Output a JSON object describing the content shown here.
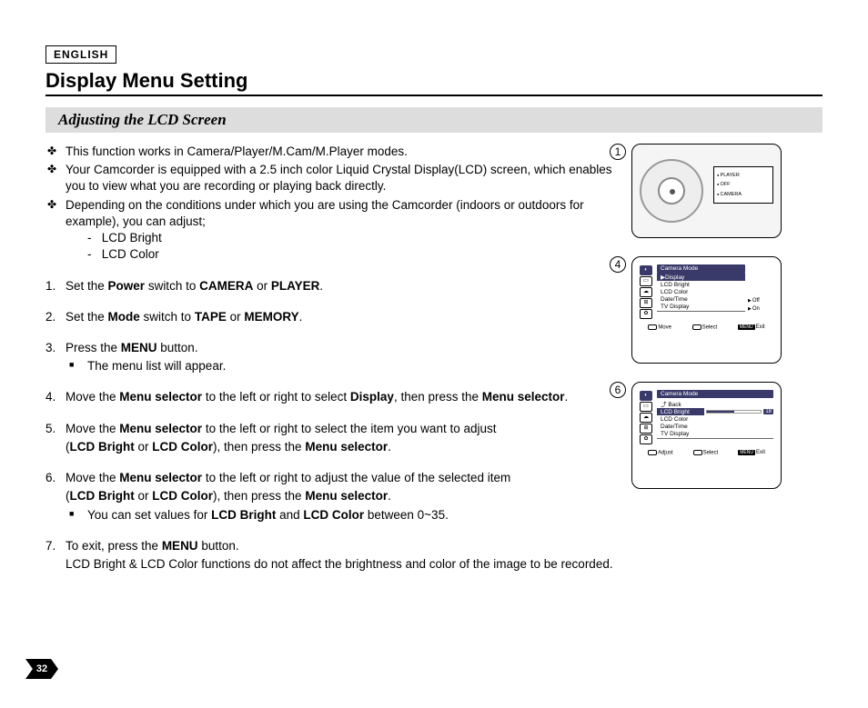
{
  "lang": "ENGLISH",
  "title": "Display Menu Setting",
  "subtitle": "Adjusting the LCD Screen",
  "bullets": [
    "This function works in Camera/Player/M.Cam/M.Player modes.",
    "Your Camcorder is equipped with a 2.5 inch color Liquid Crystal Display(LCD) screen, which enables you to view what you are recording or playing back directly.",
    "Depending on the conditions under which you are using the Camcorder (indoors or outdoors for example), you can adjust;"
  ],
  "sub_items": [
    "LCD Bright",
    "LCD Color"
  ],
  "steps": {
    "s1": {
      "n": "1.",
      "pre": "Set the ",
      "b1": "Power",
      "mid1": " switch to ",
      "b2": "CAMERA",
      "mid2": " or ",
      "b3": "PLAYER",
      "post": "."
    },
    "s2": {
      "n": "2.",
      "pre": "Set the ",
      "b1": "Mode",
      "mid1": " switch to ",
      "b2": "TAPE",
      "mid2": " or ",
      "b3": "MEMORY",
      "post": "."
    },
    "s3": {
      "n": "3.",
      "pre": "Press the ",
      "b1": "MENU",
      "post": " button.",
      "sq": "The menu list will appear."
    },
    "s4": {
      "n": "4.",
      "pre": "Move the ",
      "b1": "Menu selector",
      "mid1": " to the left or right to select ",
      "b2": "Display",
      "mid2": ", then press the ",
      "b3": "Menu selector",
      "post": "."
    },
    "s5": {
      "n": "5.",
      "pre": "Move the ",
      "b1": "Menu selector",
      "mid1": " to the left or right to select the item you want to adjust",
      "line2a": "(",
      "b2": "LCD Bright",
      "mid2": " or ",
      "b3": "LCD Color",
      "mid3": "), then press the ",
      "b4": "Menu selector",
      "post": "."
    },
    "s6": {
      "n": "6.",
      "pre": "Move the ",
      "b1": "Menu selector",
      "mid1": " to the left or right to adjust the value of the selected item",
      "line2a": "(",
      "b2": "LCD Bright",
      "mid2": " or ",
      "b3": "LCD Color",
      "mid3": "), then press the ",
      "b4": "Menu selector",
      "post": ".",
      "sq_pre": "You can set values for ",
      "sq_b1": "LCD Bright",
      "sq_mid": " and ",
      "sq_b2": "LCD Color",
      "sq_post": " between 0~35."
    },
    "s7": {
      "n": "7.",
      "pre": "To exit, press the ",
      "b1": "MENU",
      "post": " button.",
      "line2": "LCD Bright & LCD Color functions do not affect the brightness and color of the image to be recorded."
    }
  },
  "fig1": {
    "circ": "1",
    "labels": [
      "PLAYER",
      "OFF",
      "CAMERA"
    ]
  },
  "fig4": {
    "circ": "4",
    "header": "Camera Mode",
    "items": [
      "▶Display",
      "LCD Bright",
      "LCD Color",
      "Date/Time",
      "TV Display"
    ],
    "rhs": [
      "Off",
      "On"
    ],
    "foot": {
      "move": "Move",
      "select": "Select",
      "menu": "MENU",
      "exit": "Exit"
    }
  },
  "fig6": {
    "circ": "6",
    "header": "Camera Mode",
    "back": "Back",
    "items": [
      "LCD Bright",
      "LCD Color",
      "Date/Time",
      "TV Display"
    ],
    "value": "18",
    "foot": {
      "adjust": "Adjust",
      "select": "Select",
      "menu": "MENU",
      "exit": "Exit"
    }
  },
  "page": "32"
}
